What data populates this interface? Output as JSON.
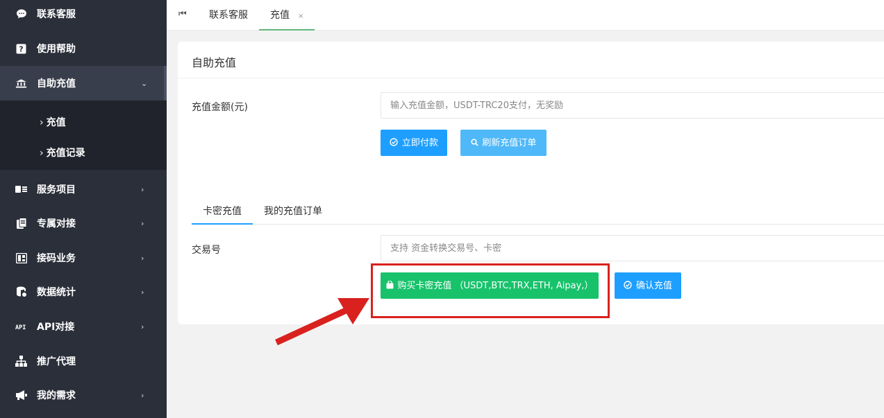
{
  "sidebar": {
    "items": [
      {
        "label": "联系客服",
        "icon": "chat-bubble-icon"
      },
      {
        "label": "使用帮助",
        "icon": "help-icon"
      },
      {
        "label": "自助充值",
        "icon": "bank-icon",
        "arrow": "⌄"
      },
      {
        "label": "服务项目",
        "icon": "card-list-icon",
        "arrow": "›"
      },
      {
        "label": "专属对接",
        "icon": "document-icon",
        "arrow": "›"
      },
      {
        "label": "接码业务",
        "icon": "code-grid-icon",
        "arrow": "›"
      },
      {
        "label": "数据统计",
        "icon": "database-icon",
        "arrow": "›"
      },
      {
        "label": "API对接",
        "icon": "api-icon",
        "arrow": "›"
      },
      {
        "label": "推广代理",
        "icon": "sitemap-icon"
      },
      {
        "label": "我的需求",
        "icon": "megaphone-icon",
        "arrow": "›"
      }
    ],
    "submenu": [
      {
        "label": "充值"
      },
      {
        "label": "充值记录"
      }
    ]
  },
  "tabs": {
    "home_icon": "⏮",
    "items": [
      {
        "label": "联系客服"
      },
      {
        "label": "充值",
        "close": "×"
      }
    ]
  },
  "card": {
    "title": "自助充值",
    "amount_label": "充值金额(元)",
    "amount_placeholder": "输入充值金额，USDT-TRC20支付，无奖励",
    "pay_button": "立即付款",
    "refresh_button": "刷新充值订单",
    "subtabs": [
      {
        "label": "卡密充值"
      },
      {
        "label": "我的充值订单"
      }
    ],
    "txn_label": "交易号",
    "txn_placeholder": "支持 资金转换交易号、卡密",
    "buy_button": "购买卡密充值 （USDT,BTC,TRX,ETH, Aipay,）",
    "confirm_button": "确认充值"
  },
  "colors": {
    "sidebar_bg": "#2b2f3a",
    "primary": "#1e9fff",
    "success": "#17c26b",
    "annotation": "#d9211e"
  }
}
